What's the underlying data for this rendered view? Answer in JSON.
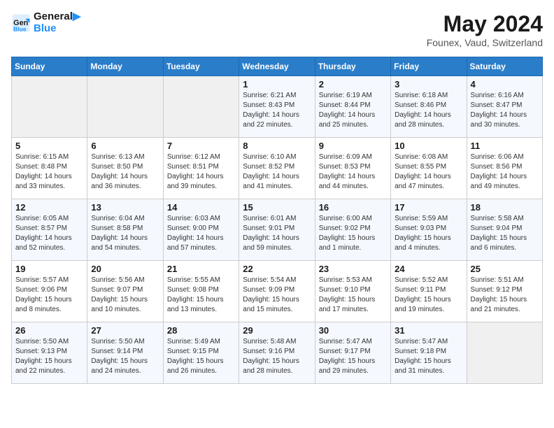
{
  "header": {
    "logo_line1": "General",
    "logo_line2": "Blue",
    "month_year": "May 2024",
    "location": "Founex, Vaud, Switzerland"
  },
  "days_of_week": [
    "Sunday",
    "Monday",
    "Tuesday",
    "Wednesday",
    "Thursday",
    "Friday",
    "Saturday"
  ],
  "weeks": [
    [
      {
        "day": "",
        "sunrise": "",
        "sunset": "",
        "daylight": ""
      },
      {
        "day": "",
        "sunrise": "",
        "sunset": "",
        "daylight": ""
      },
      {
        "day": "",
        "sunrise": "",
        "sunset": "",
        "daylight": ""
      },
      {
        "day": "1",
        "sunrise": "Sunrise: 6:21 AM",
        "sunset": "Sunset: 8:43 PM",
        "daylight": "Daylight: 14 hours and 22 minutes."
      },
      {
        "day": "2",
        "sunrise": "Sunrise: 6:19 AM",
        "sunset": "Sunset: 8:44 PM",
        "daylight": "Daylight: 14 hours and 25 minutes."
      },
      {
        "day": "3",
        "sunrise": "Sunrise: 6:18 AM",
        "sunset": "Sunset: 8:46 PM",
        "daylight": "Daylight: 14 hours and 28 minutes."
      },
      {
        "day": "4",
        "sunrise": "Sunrise: 6:16 AM",
        "sunset": "Sunset: 8:47 PM",
        "daylight": "Daylight: 14 hours and 30 minutes."
      }
    ],
    [
      {
        "day": "5",
        "sunrise": "Sunrise: 6:15 AM",
        "sunset": "Sunset: 8:48 PM",
        "daylight": "Daylight: 14 hours and 33 minutes."
      },
      {
        "day": "6",
        "sunrise": "Sunrise: 6:13 AM",
        "sunset": "Sunset: 8:50 PM",
        "daylight": "Daylight: 14 hours and 36 minutes."
      },
      {
        "day": "7",
        "sunrise": "Sunrise: 6:12 AM",
        "sunset": "Sunset: 8:51 PM",
        "daylight": "Daylight: 14 hours and 39 minutes."
      },
      {
        "day": "8",
        "sunrise": "Sunrise: 6:10 AM",
        "sunset": "Sunset: 8:52 PM",
        "daylight": "Daylight: 14 hours and 41 minutes."
      },
      {
        "day": "9",
        "sunrise": "Sunrise: 6:09 AM",
        "sunset": "Sunset: 8:53 PM",
        "daylight": "Daylight: 14 hours and 44 minutes."
      },
      {
        "day": "10",
        "sunrise": "Sunrise: 6:08 AM",
        "sunset": "Sunset: 8:55 PM",
        "daylight": "Daylight: 14 hours and 47 minutes."
      },
      {
        "day": "11",
        "sunrise": "Sunrise: 6:06 AM",
        "sunset": "Sunset: 8:56 PM",
        "daylight": "Daylight: 14 hours and 49 minutes."
      }
    ],
    [
      {
        "day": "12",
        "sunrise": "Sunrise: 6:05 AM",
        "sunset": "Sunset: 8:57 PM",
        "daylight": "Daylight: 14 hours and 52 minutes."
      },
      {
        "day": "13",
        "sunrise": "Sunrise: 6:04 AM",
        "sunset": "Sunset: 8:58 PM",
        "daylight": "Daylight: 14 hours and 54 minutes."
      },
      {
        "day": "14",
        "sunrise": "Sunrise: 6:03 AM",
        "sunset": "Sunset: 9:00 PM",
        "daylight": "Daylight: 14 hours and 57 minutes."
      },
      {
        "day": "15",
        "sunrise": "Sunrise: 6:01 AM",
        "sunset": "Sunset: 9:01 PM",
        "daylight": "Daylight: 14 hours and 59 minutes."
      },
      {
        "day": "16",
        "sunrise": "Sunrise: 6:00 AM",
        "sunset": "Sunset: 9:02 PM",
        "daylight": "Daylight: 15 hours and 1 minute."
      },
      {
        "day": "17",
        "sunrise": "Sunrise: 5:59 AM",
        "sunset": "Sunset: 9:03 PM",
        "daylight": "Daylight: 15 hours and 4 minutes."
      },
      {
        "day": "18",
        "sunrise": "Sunrise: 5:58 AM",
        "sunset": "Sunset: 9:04 PM",
        "daylight": "Daylight: 15 hours and 6 minutes."
      }
    ],
    [
      {
        "day": "19",
        "sunrise": "Sunrise: 5:57 AM",
        "sunset": "Sunset: 9:06 PM",
        "daylight": "Daylight: 15 hours and 8 minutes."
      },
      {
        "day": "20",
        "sunrise": "Sunrise: 5:56 AM",
        "sunset": "Sunset: 9:07 PM",
        "daylight": "Daylight: 15 hours and 10 minutes."
      },
      {
        "day": "21",
        "sunrise": "Sunrise: 5:55 AM",
        "sunset": "Sunset: 9:08 PM",
        "daylight": "Daylight: 15 hours and 13 minutes."
      },
      {
        "day": "22",
        "sunrise": "Sunrise: 5:54 AM",
        "sunset": "Sunset: 9:09 PM",
        "daylight": "Daylight: 15 hours and 15 minutes."
      },
      {
        "day": "23",
        "sunrise": "Sunrise: 5:53 AM",
        "sunset": "Sunset: 9:10 PM",
        "daylight": "Daylight: 15 hours and 17 minutes."
      },
      {
        "day": "24",
        "sunrise": "Sunrise: 5:52 AM",
        "sunset": "Sunset: 9:11 PM",
        "daylight": "Daylight: 15 hours and 19 minutes."
      },
      {
        "day": "25",
        "sunrise": "Sunrise: 5:51 AM",
        "sunset": "Sunset: 9:12 PM",
        "daylight": "Daylight: 15 hours and 21 minutes."
      }
    ],
    [
      {
        "day": "26",
        "sunrise": "Sunrise: 5:50 AM",
        "sunset": "Sunset: 9:13 PM",
        "daylight": "Daylight: 15 hours and 22 minutes."
      },
      {
        "day": "27",
        "sunrise": "Sunrise: 5:50 AM",
        "sunset": "Sunset: 9:14 PM",
        "daylight": "Daylight: 15 hours and 24 minutes."
      },
      {
        "day": "28",
        "sunrise": "Sunrise: 5:49 AM",
        "sunset": "Sunset: 9:15 PM",
        "daylight": "Daylight: 15 hours and 26 minutes."
      },
      {
        "day": "29",
        "sunrise": "Sunrise: 5:48 AM",
        "sunset": "Sunset: 9:16 PM",
        "daylight": "Daylight: 15 hours and 28 minutes."
      },
      {
        "day": "30",
        "sunrise": "Sunrise: 5:47 AM",
        "sunset": "Sunset: 9:17 PM",
        "daylight": "Daylight: 15 hours and 29 minutes."
      },
      {
        "day": "31",
        "sunrise": "Sunrise: 5:47 AM",
        "sunset": "Sunset: 9:18 PM",
        "daylight": "Daylight: 15 hours and 31 minutes."
      },
      {
        "day": "",
        "sunrise": "",
        "sunset": "",
        "daylight": ""
      }
    ]
  ]
}
